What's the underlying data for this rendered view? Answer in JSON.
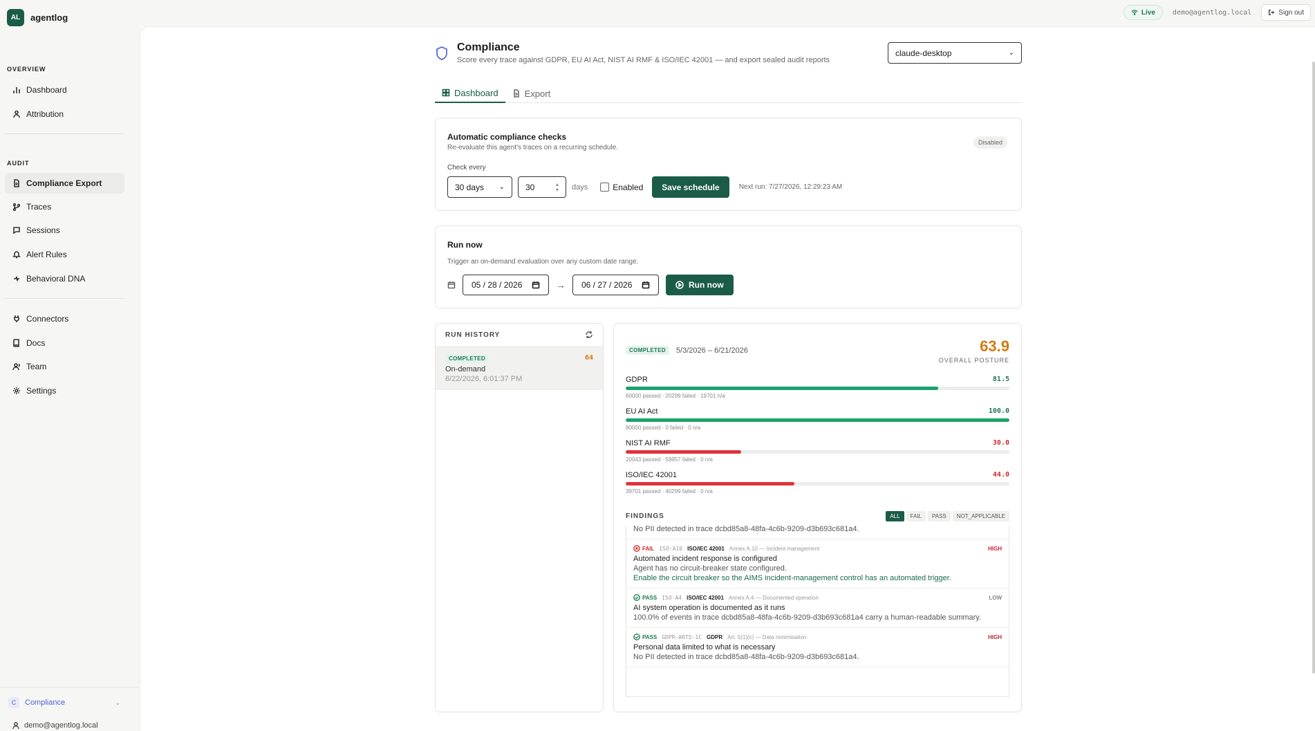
{
  "brand": {
    "logo": "AL",
    "name": "agentlog"
  },
  "topbar": {
    "live": "Live",
    "email": "demo@agentlog.local",
    "signout": "Sign out"
  },
  "sidebar": {
    "overview_label": "OVERVIEW",
    "overview": [
      {
        "label": "Dashboard",
        "icon": "bar-chart-icon"
      },
      {
        "label": "Attribution",
        "icon": "users-icon"
      }
    ],
    "audit_label": "AUDIT",
    "audit": [
      {
        "label": "Compliance Export",
        "icon": "file-icon",
        "active": true
      },
      {
        "label": "Traces",
        "icon": "branch-icon"
      },
      {
        "label": "Sessions",
        "icon": "chat-icon"
      },
      {
        "label": "Alert Rules",
        "icon": "bell-icon"
      },
      {
        "label": "Behavioral DNA",
        "icon": "dna-icon"
      }
    ],
    "other": [
      {
        "label": "Connectors",
        "icon": "plug-icon"
      },
      {
        "label": "Docs",
        "icon": "book-icon"
      },
      {
        "label": "Team",
        "icon": "team-icon"
      },
      {
        "label": "Settings",
        "icon": "gear-icon"
      }
    ],
    "org": {
      "badge": "C",
      "name": "Compliance"
    },
    "user": "demo@agentlog.local"
  },
  "page": {
    "title": "Compliance",
    "subtitle": "Score every trace against GDPR, EU AI Act, NIST AI RMF & ISO/IEC 42001 — and export sealed audit reports",
    "agent": "claude-desktop"
  },
  "tabs": [
    {
      "label": "Dashboard",
      "active": true
    },
    {
      "label": "Export",
      "active": false
    }
  ],
  "schedule": {
    "title": "Automatic compliance checks",
    "subtitle": "Re-evaluate this agent's traces on a recurring schedule.",
    "badge": "Disabled",
    "check_every_label": "Check every",
    "interval": "30 days",
    "count": "30",
    "unit": "days",
    "enabled_label": "Enabled",
    "save": "Save schedule",
    "next_run": "Next run: 7/27/2026, 12:29:23 AM"
  },
  "run_now": {
    "title": "Run now",
    "subtitle": "Trigger an on-demand evaluation over any custom date range.",
    "from": "05 / 28 / 2026",
    "to": "06 / 27 / 2026",
    "arrow": "→",
    "button": "Run now"
  },
  "history": {
    "title": "RUN HISTORY",
    "item": {
      "status": "COMPLETED",
      "score": "64",
      "type": "On-demand",
      "time": "6/22/2026, 6:01:37 PM"
    }
  },
  "result": {
    "status": "COMPLETED",
    "range": "5/3/2026 – 6/21/2026",
    "score": "63.9",
    "score_label": "OVERALL POSTURE",
    "frameworks": [
      {
        "name": "GDPR",
        "score": "81.5",
        "value": 81.5,
        "meta": "60000 passed · 20299 failed · 19701 n/a",
        "color": "#1aa36a",
        "score_color": "#1a7a52"
      },
      {
        "name": "EU AI Act",
        "score": "100.0",
        "value": 100,
        "meta": "80000 passed · 0 failed · 0 n/a",
        "color": "#1aa36a",
        "score_color": "#1a7a52"
      },
      {
        "name": "NIST AI RMF",
        "score": "30.0",
        "value": 30,
        "meta": "20043 passed · 59957 failed · 0 n/a",
        "color": "#e0323a",
        "score_color": "#d02a2a"
      },
      {
        "name": "ISO/IEC 42001",
        "score": "44.0",
        "value": 44,
        "meta": "39701 passed · 40299 failed · 0 n/a",
        "color": "#e0323a",
        "score_color": "#d02a2a"
      }
    ],
    "findings_title": "FINDINGS",
    "filters": [
      "ALL",
      "FAIL",
      "PASS",
      "NOT_APPLICABLE"
    ],
    "partial_top": "No PII detected in trace dcbd85a8-48fa-4c6b-9209-d3b693c681a4.",
    "findings": [
      {
        "status": "FAIL",
        "code": "ISO-A10",
        "framework": "ISO/IEC 42001",
        "clause": "Annex A.10 — Incident management",
        "severity": "HIGH",
        "title": "Automated incident response is configured",
        "detail": "Agent has no circuit-breaker state configured.",
        "remediation": "Enable the circuit breaker so the AIMS incident-management control has an automated trigger."
      },
      {
        "status": "PASS",
        "code": "ISO-A4",
        "framework": "ISO/IEC 42001",
        "clause": "Annex A.4 — Documented operation",
        "severity": "LOW",
        "title": "AI system operation is documented as it runs",
        "detail": "100.0% of events in trace dcbd85a8-48fa-4c6b-9209-d3b693c681a4 carry a human-readable summary.",
        "remediation": ""
      },
      {
        "status": "PASS",
        "code": "GDPR-ART5-1C",
        "framework": "GDPR",
        "clause": "Art. 5(1)(c) — Data minimisation",
        "severity": "HIGH",
        "title": "Personal data limited to what is necessary",
        "detail": "No PII detected in trace dcbd85a8-48fa-4c6b-9209-d3b693c681a4.",
        "remediation": ""
      }
    ]
  }
}
